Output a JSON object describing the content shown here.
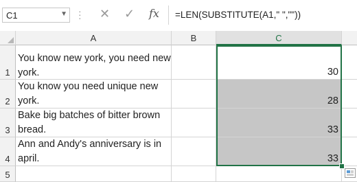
{
  "formula_bar": {
    "name_box": "C1",
    "cancel_icon": "✕",
    "enter_icon": "✓",
    "fx_label": "fx",
    "formula": "=LEN(SUBSTITUTE(A1,\" \",\"\"))"
  },
  "columns": [
    "A",
    "B",
    "C"
  ],
  "rows": [
    {
      "num": "1",
      "a": "You know new york, you need new york.",
      "b": "",
      "c": "30"
    },
    {
      "num": "2",
      "a": "You know you need unique new york.",
      "b": "",
      "c": "28"
    },
    {
      "num": "3",
      "a": "Bake big batches of bitter brown bread.",
      "b": "",
      "c": "33"
    },
    {
      "num": "4",
      "a": "Ann and Andy's anniversary is in april.",
      "b": "",
      "c": "33"
    },
    {
      "num": "5",
      "a": "",
      "b": "",
      "c": ""
    }
  ],
  "colors": {
    "selection_border": "#217346",
    "selection_fill": "#c6c6c6",
    "header_bg": "#f2f2f2"
  }
}
